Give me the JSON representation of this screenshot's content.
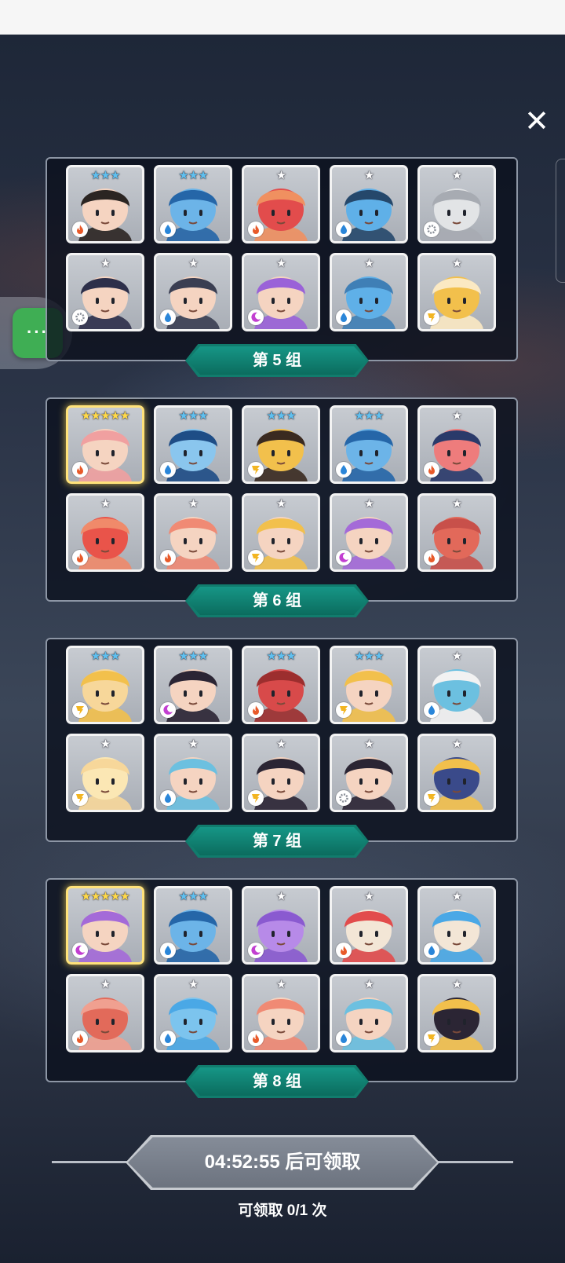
{
  "ui": {
    "close_label": "✕",
    "wechat_label": "···"
  },
  "elements": {
    "fire": {
      "color": "#e85a2a"
    },
    "water": {
      "color": "#2a86d9"
    },
    "light": {
      "color": "#f2b522"
    },
    "dark": {
      "color": "#c23fd1"
    },
    "gear": {
      "color": "#8a8f98"
    }
  },
  "star_colors": {
    "1": "#ffffff",
    "3": "#5fc0f0",
    "5": "#ffd94a"
  },
  "groups": [
    {
      "label": "第 5 组",
      "cards": [
        {
          "stars": 3,
          "element": "fire",
          "skin": "#f5d4c1",
          "hair": "#2b2522",
          "name": "hero-warrior-red-mask"
        },
        {
          "stars": 3,
          "element": "water",
          "skin": "#6cb4e8",
          "hair": "#2566a8",
          "name": "hero-blue-book"
        },
        {
          "stars": 1,
          "element": "fire",
          "skin": "#e24c4c",
          "hair": "#f09060",
          "name": "hero-red-flower-monster"
        },
        {
          "stars": 1,
          "element": "water",
          "skin": "#5fb0e8",
          "hair": "#25486b",
          "name": "hero-blue-skull"
        },
        {
          "stars": 1,
          "element": "gear",
          "skin": "#e2e4e6",
          "hair": "#a7abb2",
          "name": "hero-white-dragon"
        },
        {
          "stars": 1,
          "element": "gear",
          "skin": "#f5d4c1",
          "hair": "#2d2f4a",
          "name": "hero-dark-hair-girl"
        },
        {
          "stars": 1,
          "element": "water",
          "skin": "#f5d4c1",
          "hair": "#3a3e52",
          "name": "hero-knight-helmet"
        },
        {
          "stars": 1,
          "element": "dark",
          "skin": "#f5d4c1",
          "hair": "#9a62d8",
          "name": "hero-purple-hair-girl"
        },
        {
          "stars": 1,
          "element": "water",
          "skin": "#5fb0e8",
          "hair": "#3f7fb6",
          "name": "hero-blue-totem"
        },
        {
          "stars": 1,
          "element": "light",
          "skin": "#f2c04c",
          "hair": "#fbe9c3",
          "name": "hero-yellow-mummy"
        }
      ]
    },
    {
      "label": "第 6 组",
      "cards": [
        {
          "stars": 5,
          "element": "fire",
          "skin": "#f5d4c1",
          "hair": "#f0a0a0",
          "name": "hero-pink-hair-horn",
          "gold": true
        },
        {
          "stars": 3,
          "element": "water",
          "skin": "#8ac6ee",
          "hair": "#1e4d86",
          "name": "hero-blue-hood"
        },
        {
          "stars": 3,
          "element": "light",
          "skin": "#f2c04c",
          "hair": "#3a2a20",
          "name": "hero-lion"
        },
        {
          "stars": 3,
          "element": "water",
          "skin": "#6cb4e8",
          "hair": "#2566a8",
          "name": "hero-blue-book-2"
        },
        {
          "stars": 1,
          "element": "fire",
          "skin": "#ee7c7c",
          "hair": "#2a3a6a",
          "name": "hero-red-skull"
        },
        {
          "stars": 1,
          "element": "fire",
          "skin": "#e9544a",
          "hair": "#f08a6a",
          "name": "hero-red-bird"
        },
        {
          "stars": 1,
          "element": "fire",
          "skin": "#f5d4c1",
          "hair": "#f08a74",
          "name": "hero-red-haired-girl"
        },
        {
          "stars": 1,
          "element": "light",
          "skin": "#f5d4c1",
          "hair": "#f2c04c",
          "name": "hero-witch-hat"
        },
        {
          "stars": 1,
          "element": "dark",
          "skin": "#f5d4c1",
          "hair": "#a46ad8",
          "name": "hero-purple-girl"
        },
        {
          "stars": 1,
          "element": "fire",
          "skin": "#e2695a",
          "hair": "#c8504a",
          "name": "hero-red-totem"
        }
      ]
    },
    {
      "label": "第 7 组",
      "cards": [
        {
          "stars": 3,
          "element": "light",
          "skin": "#f7d79a",
          "hair": "#f2c04c",
          "name": "hero-yellow-beast"
        },
        {
          "stars": 3,
          "element": "dark",
          "skin": "#f5d4c1",
          "hair": "#2b2534",
          "name": "hero-dark-prince"
        },
        {
          "stars": 3,
          "element": "fire",
          "skin": "#d84a4a",
          "hair": "#9c2e2e",
          "name": "hero-red-book"
        },
        {
          "stars": 3,
          "element": "light",
          "skin": "#f5d4c1",
          "hair": "#f2c04c",
          "name": "hero-golden-crown"
        },
        {
          "stars": 1,
          "element": "water",
          "skin": "#6cc0e0",
          "hair": "#f2f2f2",
          "name": "hero-blue-bandage"
        },
        {
          "stars": 1,
          "element": "light",
          "skin": "#fbe7b4",
          "hair": "#f7d79a",
          "name": "hero-cream-ghost"
        },
        {
          "stars": 1,
          "element": "water",
          "skin": "#f5d4c1",
          "hair": "#6cc0e0",
          "name": "hero-blue-hair-girl"
        },
        {
          "stars": 1,
          "element": "light",
          "skin": "#f5d4c1",
          "hair": "#2b2534",
          "name": "hero-gold-helmet-boy"
        },
        {
          "stars": 1,
          "element": "gear",
          "skin": "#f5d4c1",
          "hair": "#2b2534",
          "name": "hero-silver-helmet-boy"
        },
        {
          "stars": 1,
          "element": "light",
          "skin": "#3a4a8a",
          "hair": "#f2c04c",
          "name": "hero-gold-knight"
        }
      ]
    },
    {
      "label": "第 8 组",
      "cards": [
        {
          "stars": 5,
          "element": "dark",
          "skin": "#f5d4c1",
          "hair": "#a46ad8",
          "name": "hero-purple-long-hair",
          "gold": true
        },
        {
          "stars": 3,
          "element": "water",
          "skin": "#6cb4e8",
          "hair": "#2566a8",
          "name": "hero-blue-book-3"
        },
        {
          "stars": 1,
          "element": "dark",
          "skin": "#b78ae8",
          "hair": "#8a5ad0",
          "name": "hero-purple-cactus"
        },
        {
          "stars": 1,
          "element": "fire",
          "skin": "#f3e6d6",
          "hair": "#e24c4c",
          "name": "hero-red-fox"
        },
        {
          "stars": 1,
          "element": "water",
          "skin": "#f3e6d6",
          "hair": "#4aa8e6",
          "name": "hero-blue-fox"
        },
        {
          "stars": 1,
          "element": "fire",
          "skin": "#e26a5a",
          "hair": "#f0a090",
          "name": "hero-red-shell"
        },
        {
          "stars": 1,
          "element": "water",
          "skin": "#7cc4ee",
          "hair": "#4aa8e6",
          "name": "hero-blue-moai"
        },
        {
          "stars": 1,
          "element": "fire",
          "skin": "#f5d4c1",
          "hair": "#f08a74",
          "name": "hero-red-antenna-girl"
        },
        {
          "stars": 1,
          "element": "water",
          "skin": "#f5d4c1",
          "hair": "#6cc0e0",
          "name": "hero-blue-antenna-girl"
        },
        {
          "stars": 1,
          "element": "light",
          "skin": "#2b2534",
          "hair": "#f2c04c",
          "name": "hero-gold-chest"
        }
      ]
    }
  ],
  "claim": {
    "button_label": "04:52:55 后可领取",
    "count_text": "可领取 0/1 次"
  }
}
